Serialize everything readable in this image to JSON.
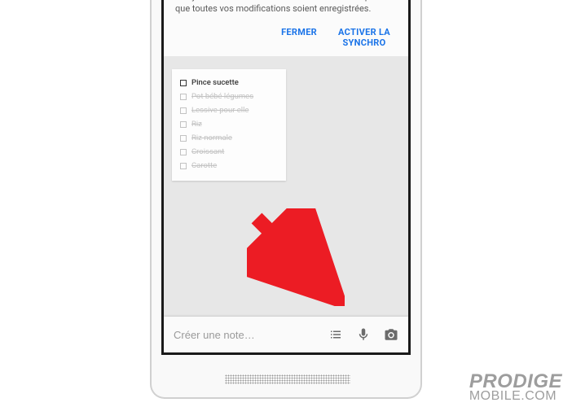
{
  "banner": {
    "message": "La synchronisation est désactivée. Réactivez-la pour que toutes vos modifications soient enregistrées.",
    "close_label": "FERMER",
    "activate_label_line1": "ACTIVER LA",
    "activate_label_line2": "SYNCHRO"
  },
  "note_card": {
    "items": [
      {
        "label": "Pince sucette",
        "checked": false,
        "active": true
      },
      {
        "label": "Pot bébé légumes",
        "checked": true,
        "active": false
      },
      {
        "label": "Lessive pour elle",
        "checked": true,
        "active": false
      },
      {
        "label": "Riz",
        "checked": true,
        "active": false
      },
      {
        "label": "Riz normale",
        "checked": true,
        "active": false
      },
      {
        "label": "Croissant",
        "checked": true,
        "active": false
      },
      {
        "label": "Carotte",
        "checked": true,
        "active": false
      }
    ]
  },
  "bottom_bar": {
    "placeholder": "Créer une note…"
  },
  "watermark": {
    "line1": "PRODIGE",
    "line2": "MOBILE.COM"
  },
  "annotation": {
    "arrow_color": "#ec1c24"
  }
}
